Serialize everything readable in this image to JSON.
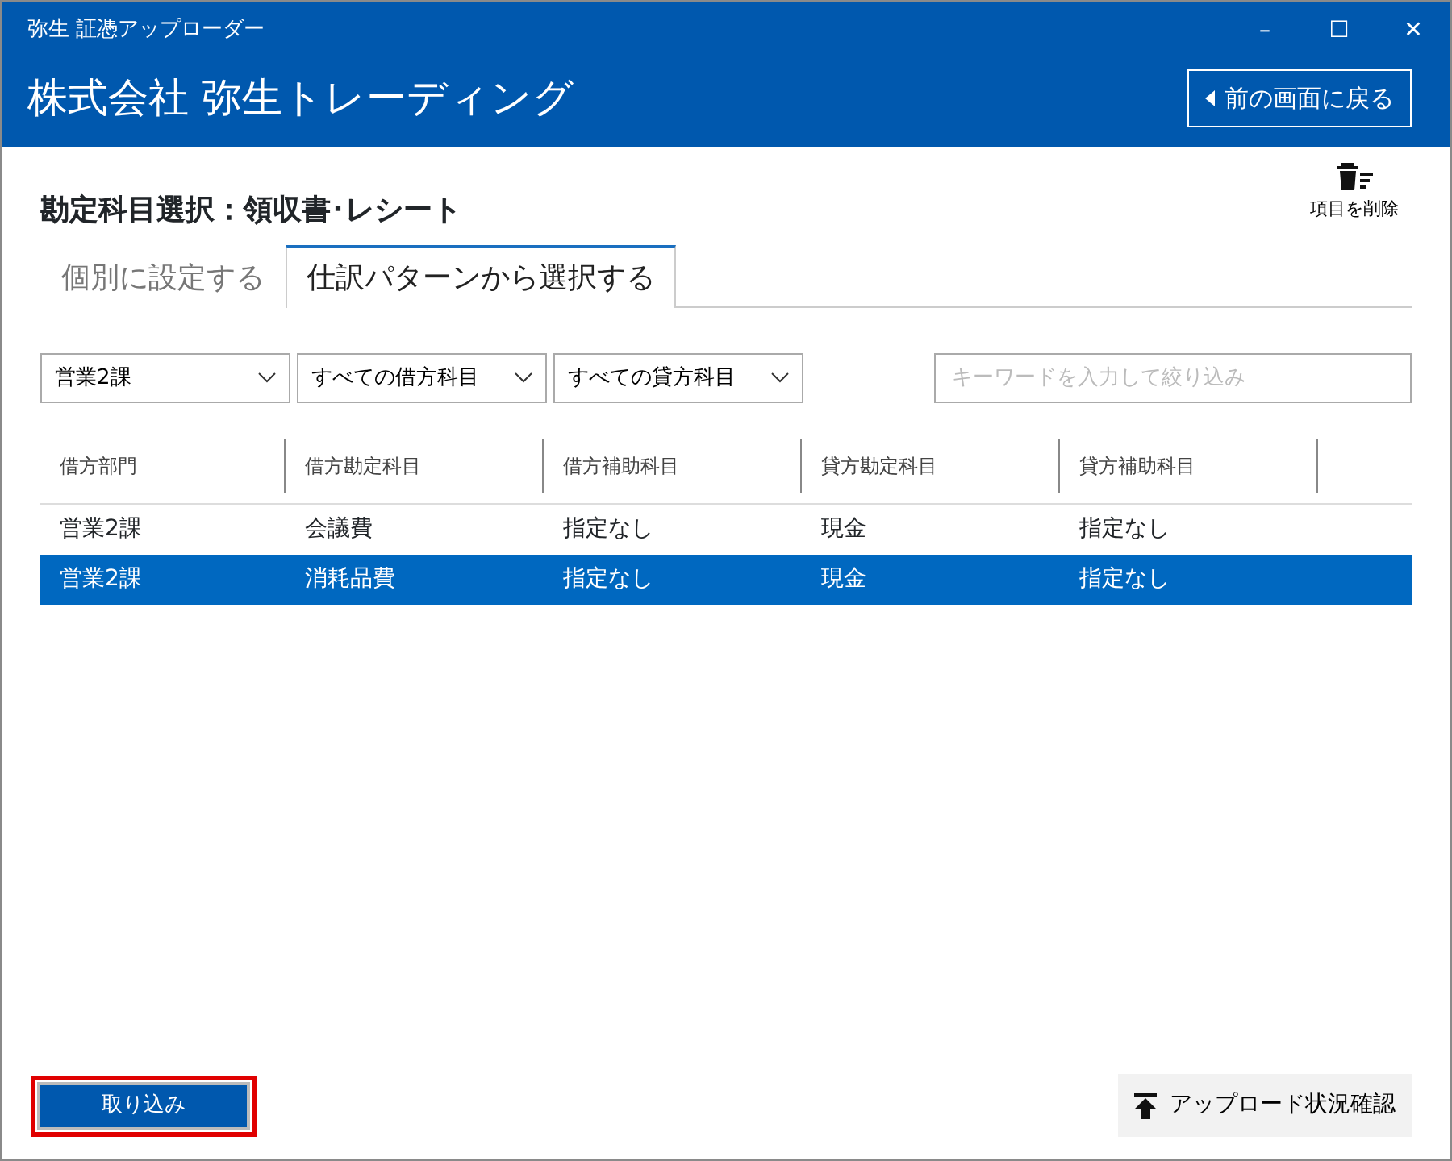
{
  "window": {
    "title": "弥生 証憑アップローダー",
    "controls": [
      "–",
      "☐",
      "✕"
    ]
  },
  "header": {
    "company": "株式会社 弥生トレーディング",
    "back_button": "前の画面に戻る"
  },
  "page_title": "勘定科目選択：領収書･レシート",
  "delete_button": "項目を削除",
  "tabs": [
    {
      "label": "個別に設定する",
      "selected": false
    },
    {
      "label": "仕訳パターンから選択する",
      "selected": true
    }
  ],
  "filters": {
    "dropdowns": [
      "営業2課",
      "すべての借方科目",
      "すべての貸方科目"
    ],
    "search": {
      "placeholder": "キーワードを入力して絞り込み"
    }
  },
  "table": {
    "columns": [
      "借方部門",
      "借方勘定科目",
      "借方補助科目",
      "貸方勘定科目",
      "貸方補助科目"
    ],
    "rows": [
      {
        "cells": [
          "営業2課",
          "会議費",
          "指定なし",
          "現金",
          "指定なし"
        ],
        "selected": false
      },
      {
        "cells": [
          "営業2課",
          "消耗品費",
          "指定なし",
          "現金",
          "指定なし"
        ],
        "selected": true
      }
    ]
  },
  "import_button": {
    "label": "取り込み",
    "highlighted": true
  },
  "upload_status_button": "アップロード状況確認"
}
